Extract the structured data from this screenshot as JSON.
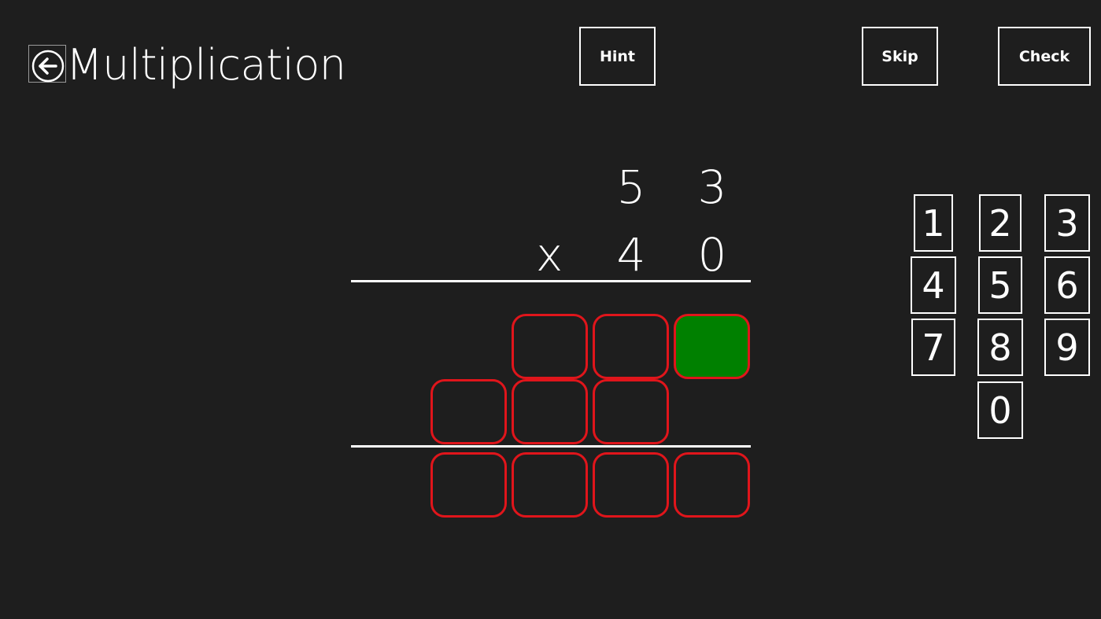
{
  "header": {
    "title": "Multiplication",
    "back_icon": "arrow-left-circle-icon"
  },
  "commands": {
    "hint_label": "Hint",
    "skip_label": "Skip",
    "check_label": "Check"
  },
  "problem": {
    "multiplicand": [
      "5",
      "3"
    ],
    "operator": "x",
    "multiplier": [
      "4",
      "0"
    ]
  },
  "answer": {
    "partial_row_1": [
      "",
      "",
      ""
    ],
    "partial_row_2": [
      "",
      "",
      ""
    ],
    "result_row": [
      "",
      "",
      "",
      ""
    ],
    "active_cell": "partial_row_1.2"
  },
  "keypad": {
    "keys": [
      "1",
      "2",
      "3",
      "4",
      "5",
      "6",
      "7",
      "8",
      "9",
      "0"
    ]
  },
  "colors": {
    "background": "#1e1e1e",
    "box_border": "#e0151b",
    "active_box": "#008000",
    "foreground": "#ffffff"
  }
}
